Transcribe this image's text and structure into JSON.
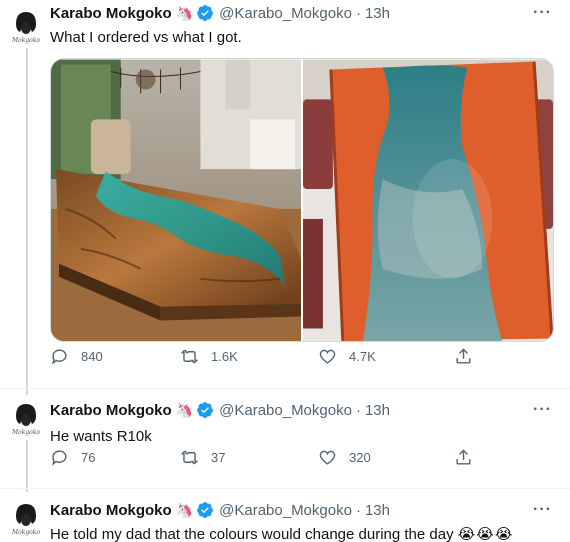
{
  "tweets": [
    {
      "name": "Karabo Mokgoko",
      "badge_emoji": "🦄",
      "handle": "@Karabo_Mokgoko",
      "dot": "·",
      "time": "13h",
      "more": "···",
      "text": "What I ordered vs what I got.",
      "actions": {
        "reply": "840",
        "retweet": "1.6K",
        "like": "4.7K"
      }
    },
    {
      "name": "Karabo Mokgoko",
      "badge_emoji": "🦄",
      "handle": "@Karabo_Mokgoko",
      "dot": "·",
      "time": "13h",
      "more": "···",
      "text": "He wants R10k",
      "actions": {
        "reply": "76",
        "retweet": "37",
        "like": "320"
      }
    },
    {
      "name": "Karabo Mokgoko",
      "badge_emoji": "🦄",
      "handle": "@Karabo_Mokgoko",
      "dot": "·",
      "time": "13h",
      "more": "···",
      "text": "He told my dad that the colours would change during the day",
      "text_emoji": "😭😭😭"
    }
  ],
  "icons": {
    "verified": "verified-badge-icon",
    "reply": "reply-icon",
    "retweet": "retweet-icon",
    "like": "heart-icon",
    "share": "share-icon"
  },
  "colors": {
    "verified": "#1d9bf0",
    "secondary_text": "#536471",
    "thread_line": "#cfd9de",
    "resin_teal": "#2fa39a",
    "orange_paint": "#e0612d"
  }
}
